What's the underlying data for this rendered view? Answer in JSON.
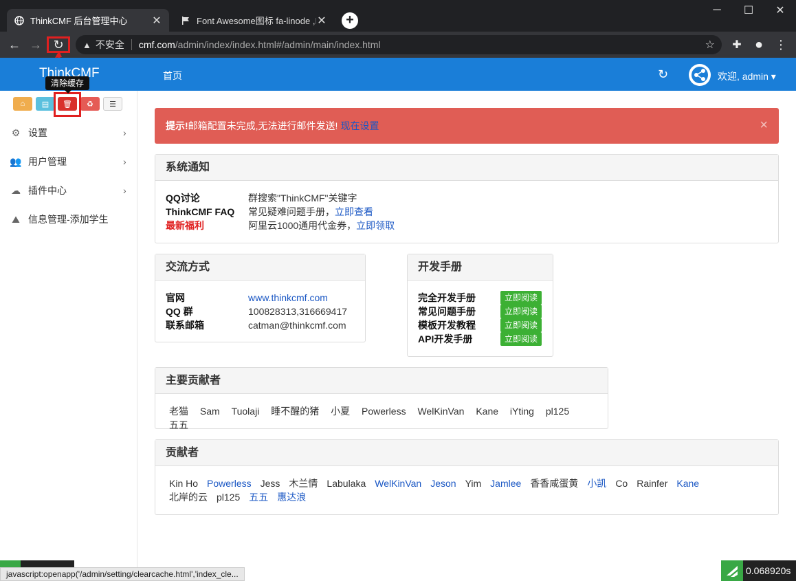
{
  "browser": {
    "tabs": [
      {
        "title": "ThinkCMF 后台管理中心",
        "close": "✕"
      },
      {
        "title": "Font Awesome图标 fa-linode ,I",
        "close": "✕"
      }
    ],
    "new_tab": "+",
    "window_controls": {
      "minimize": "─",
      "maximize": "☐",
      "close": "✕"
    },
    "back": "←",
    "forward": "→",
    "reload": "↻",
    "security_label": "不安全",
    "url_host": "cmf.com",
    "url_path": "/admin/index/index.html#/admin/main/index.html",
    "star": "☆",
    "extensions": "✚",
    "profile": "●",
    "menu": "⋮"
  },
  "header": {
    "brand": "ThinkCMF",
    "nav_home": "首页",
    "refresh": "↻",
    "user": "欢迎, admin ▾"
  },
  "tooltip": "清除缓存",
  "quick_buttons": [
    {
      "icon": "home-icon",
      "glyph": "⌂",
      "color": "#f0ad4e"
    },
    {
      "icon": "file-icon",
      "glyph": "▤",
      "color": "#5bc0de"
    },
    {
      "icon": "trash-icon",
      "glyph": "🗑",
      "color": "#d9302c"
    },
    {
      "icon": "recycle-icon",
      "glyph": "♻",
      "color": "#e55b55"
    },
    {
      "icon": "list-icon",
      "glyph": "☰",
      "color": "#f5f5f5"
    }
  ],
  "sidebar": {
    "items": [
      {
        "label": "设置",
        "arrow": "›",
        "icon": "cogs-icon",
        "glyph": "⚙"
      },
      {
        "label": "用户管理",
        "arrow": "›",
        "icon": "users-icon",
        "glyph": "👥"
      },
      {
        "label": "插件中心",
        "arrow": "›",
        "icon": "cloud-icon",
        "glyph": "☁"
      },
      {
        "label": "信息管理-添加学生",
        "arrow": "",
        "icon": "linode-icon",
        "glyph": "⛰"
      }
    ]
  },
  "alert": {
    "strong": "提示!",
    "text": " 邮箱配置未完成,无法进行邮件发送!",
    "link": "现在设置",
    "close": "×"
  },
  "system_notice": {
    "title": "系统通知",
    "rows": [
      {
        "key": "QQ讨论",
        "value": "群搜索\"ThinkCMF\"关键字",
        "link": ""
      },
      {
        "key": "ThinkCMF FAQ",
        "value": "常见疑难问题手册，",
        "link": "立即查看"
      },
      {
        "key": "最新福利",
        "value": "阿里云1000通用代金券，",
        "link": "立即领取"
      }
    ]
  },
  "contact": {
    "title": "交流方式",
    "rows": [
      {
        "key": "官网",
        "value": "www.thinkcmf.com"
      },
      {
        "key": "QQ 群",
        "value": "100828313,316669417"
      },
      {
        "key": "联系邮箱",
        "value": "catman@thinkcmf.com"
      }
    ]
  },
  "dev_manual": {
    "title": "开发手册",
    "rows": [
      {
        "key": "完全开发手册",
        "button": "立即阅读"
      },
      {
        "key": "常见问题手册",
        "button": "立即阅读"
      },
      {
        "key": "模板开发教程",
        "button": "立即阅读"
      },
      {
        "key": "API开发手册",
        "button": "立即阅读"
      }
    ]
  },
  "main_contributors": {
    "title": "主要贡献者",
    "names": [
      "老猫",
      "Sam",
      "Tuolaji",
      "睡不醒的猪",
      "小夏",
      "Powerless",
      "WelKinVan",
      "Kane",
      "iYting",
      "pl125",
      "五五"
    ]
  },
  "contributors": {
    "title": "贡献者",
    "names": [
      {
        "name": "Kin Ho",
        "link": false
      },
      {
        "name": "Powerless",
        "link": true
      },
      {
        "name": "Jess",
        "link": false
      },
      {
        "name": "木兰情",
        "link": false
      },
      {
        "name": "Labulaka",
        "link": false
      },
      {
        "name": "WelKinVan",
        "link": true
      },
      {
        "name": "Jeson",
        "link": true
      },
      {
        "name": "Yim",
        "link": false
      },
      {
        "name": "Jamlee",
        "link": true
      },
      {
        "name": "香香咸蛋黄",
        "link": false
      },
      {
        "name": "小凯",
        "link": true
      },
      {
        "name": "Co",
        "link": false
      },
      {
        "name": "Rainfer",
        "link": false
      },
      {
        "name": "Kane",
        "link": true
      },
      {
        "name": "北岸的云",
        "link": false
      },
      {
        "name": "pl125",
        "link": false
      },
      {
        "name": "五五",
        "link": true
      },
      {
        "name": "惠达浪",
        "link": true
      }
    ]
  },
  "status_bar": "javascript:openapp('/admin/setting/clearcache.html','index_cle...",
  "timer": "0.068920s",
  "colors": {
    "appbar": "#1a7ed8",
    "alert": "#e05d55",
    "link": "#1a57c4",
    "annotation": "#e02020"
  }
}
